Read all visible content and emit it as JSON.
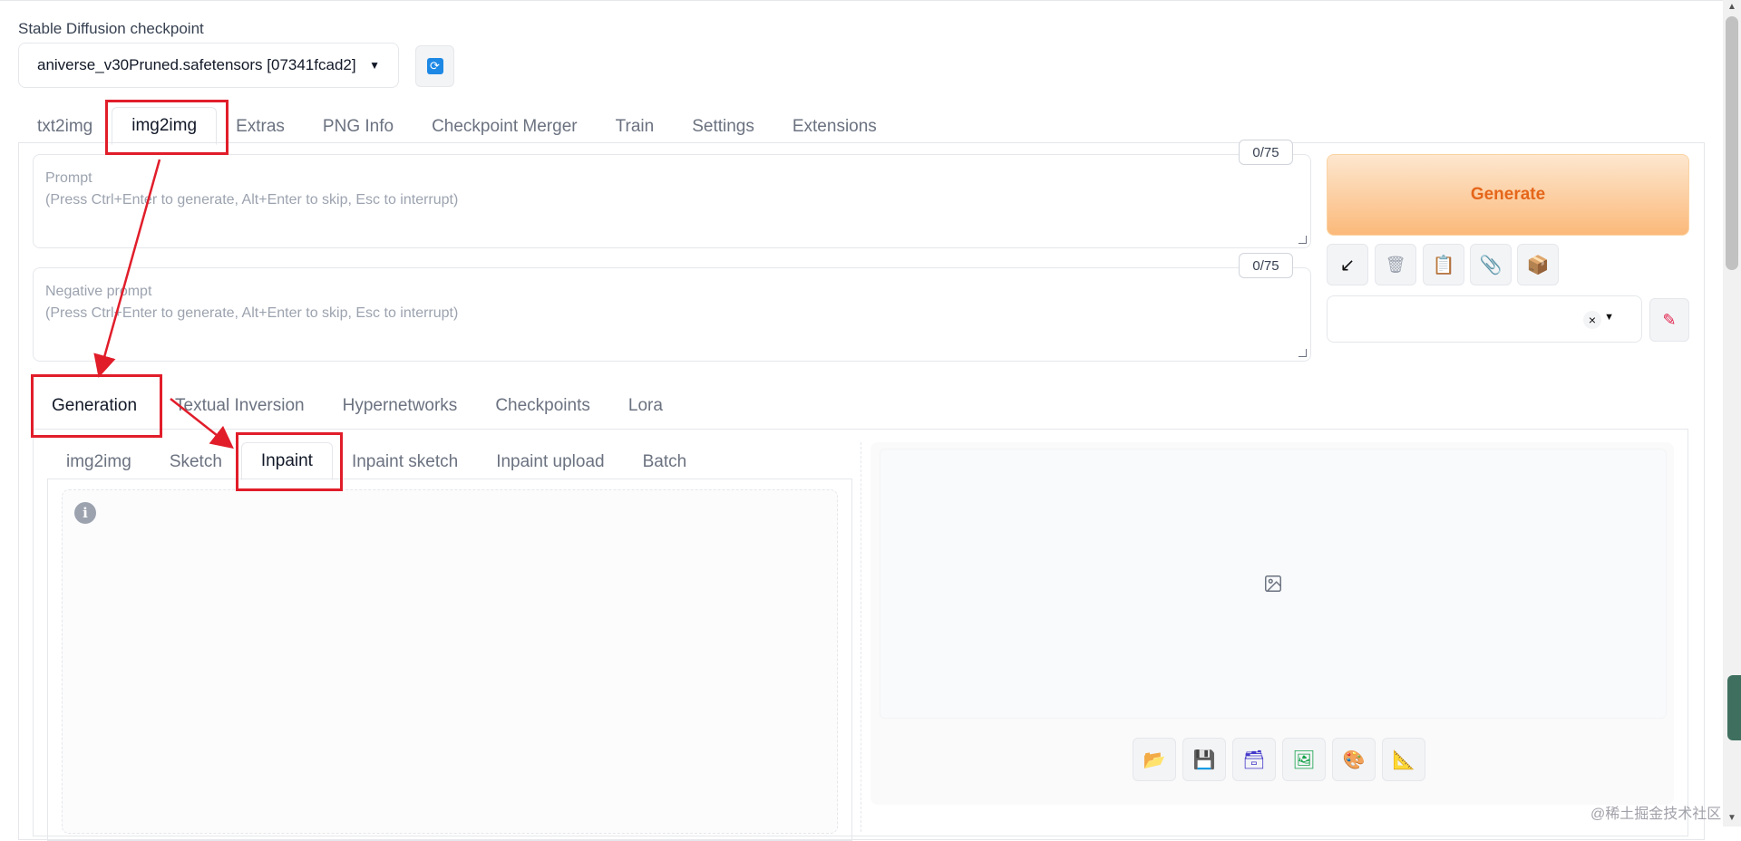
{
  "checkpoint": {
    "label": "Stable Diffusion checkpoint",
    "value": "aniverse_v30Pruned.safetensors [07341fcad2]"
  },
  "main_tabs": [
    "txt2img",
    "img2img",
    "Extras",
    "PNG Info",
    "Checkpoint Merger",
    "Train",
    "Settings",
    "Extensions"
  ],
  "prompt": {
    "label": "Prompt",
    "hint": "(Press Ctrl+Enter to generate, Alt+Enter to skip, Esc to interrupt)",
    "counter": "0/75"
  },
  "negative_prompt": {
    "label": "Negative prompt",
    "hint": "(Press Ctrl+Enter to generate, Alt+Enter to skip, Esc to interrupt)",
    "counter": "0/75"
  },
  "generate_label": "Generate",
  "tool_icons": [
    "arrow-down-left-icon",
    "trash-icon",
    "clipboard-icon",
    "paperclip-icon",
    "package-icon"
  ],
  "style_clear": "×",
  "gen_tabs": [
    "Generation",
    "Textual Inversion",
    "Hypernetworks",
    "Checkpoints",
    "Lora"
  ],
  "sub_tabs": [
    "img2img",
    "Sketch",
    "Inpaint",
    "Inpaint sketch",
    "Inpaint upload",
    "Batch"
  ],
  "info_icon": "i",
  "output_icons": [
    "folder-icon",
    "save-icon",
    "zip-icon",
    "image-icon",
    "palette-icon",
    "ruler-icon"
  ],
  "colors": {
    "accent": "#e5661a",
    "annotation": "#e11d2a",
    "link": "#1e88e5"
  },
  "watermark": "@稀土掘金技术社区"
}
